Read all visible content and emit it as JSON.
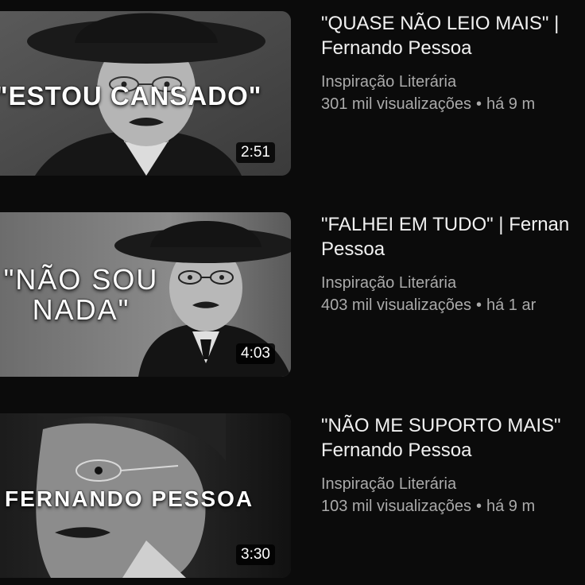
{
  "videos": [
    {
      "thumbnail_text": "\"ESTOU CANSADO\"",
      "duration": "2:51",
      "title_line1": "\"QUASE NÃO LEIO MAIS\" |",
      "title_line2": "Fernando Pessoa",
      "channel": "Inspiração Literária",
      "views": "301 mil visualizações",
      "separator": "•",
      "age": "há 9 m"
    },
    {
      "thumbnail_text_line1": "\"NÃO SOU",
      "thumbnail_text_line2": "NADA\"",
      "duration": "4:03",
      "title_line1": "\"FALHEI EM TUDO\" | Fernan",
      "title_line2": "Pessoa",
      "channel": "Inspiração Literária",
      "views": "403 mil visualizações",
      "separator": "•",
      "age": "há 1 ar"
    },
    {
      "thumbnail_text": "FERNANDO PESSOA",
      "duration": "3:30",
      "title_line1": "\"NÃO ME SUPORTO MAIS\"",
      "title_line2": "Fernando Pessoa",
      "channel": "Inspiração Literária",
      "views": "103 mil visualizações",
      "separator": "•",
      "age": "há 9 m"
    }
  ]
}
